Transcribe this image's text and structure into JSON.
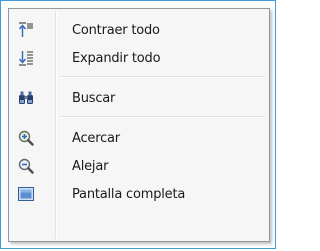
{
  "menu": {
    "items": [
      {
        "label": "Contraer todo",
        "icon": "collapse-all-icon"
      },
      {
        "label": "Expandir todo",
        "icon": "expand-all-icon"
      },
      {
        "label": "Buscar",
        "icon": "binoculars-icon"
      },
      {
        "label": "Acercar",
        "icon": "zoom-in-icon"
      },
      {
        "label": "Alejar",
        "icon": "zoom-out-icon"
      },
      {
        "label": "Pantalla completa",
        "icon": "fullscreen-icon"
      }
    ]
  },
  "colors": {
    "frame_border": "#3e9ad8",
    "menu_background": "#f6f6f6",
    "icon_blue": "#2f6bb8"
  }
}
